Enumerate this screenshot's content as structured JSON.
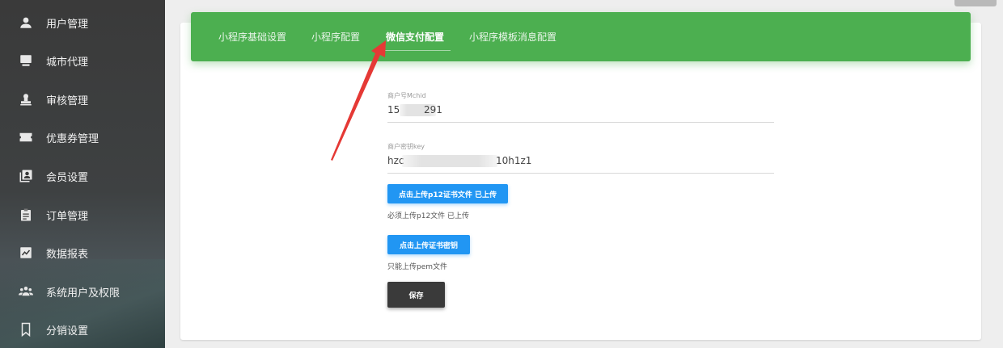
{
  "sidebar": {
    "items": [
      {
        "label": "用户管理",
        "icon": "user-icon"
      },
      {
        "label": "城市代理",
        "icon": "monitor-icon"
      },
      {
        "label": "审核管理",
        "icon": "stamp-icon"
      },
      {
        "label": "优惠券管理",
        "icon": "ticket-icon"
      },
      {
        "label": "会员设置",
        "icon": "member-card-icon"
      },
      {
        "label": "订单管理",
        "icon": "clipboard-icon"
      },
      {
        "label": "数据报表",
        "icon": "chart-icon"
      },
      {
        "label": "系统用户及权限",
        "icon": "group-icon"
      },
      {
        "label": "分销设置",
        "icon": "bookmark-icon"
      }
    ]
  },
  "tabs": [
    {
      "label": "小程序基础设置",
      "active": false
    },
    {
      "label": "小程序配置",
      "active": false
    },
    {
      "label": "微信支付配置",
      "active": true
    },
    {
      "label": "小程序模板消息配置",
      "active": false
    }
  ],
  "form": {
    "mchid": {
      "label": "商户号Mchid",
      "value_start": "15",
      "value_end": "291"
    },
    "key": {
      "label": "商户密钥key",
      "value_start": "hzc",
      "value_end": "10h1z1"
    },
    "upload_p12_button": "点击上传p12证书文件 已上传",
    "upload_p12_hint": "必须上传p12文件 已上传",
    "upload_key_button": "点击上传证书密钥",
    "upload_key_hint": "只能上传pem文件",
    "save_button": "保存"
  },
  "colors": {
    "tab_bar": "#4caf50",
    "primary_button": "#2196f3",
    "save_button": "#3a3a3a",
    "annotation_arrow": "#e53935",
    "sidebar": "#3a3a3a"
  }
}
